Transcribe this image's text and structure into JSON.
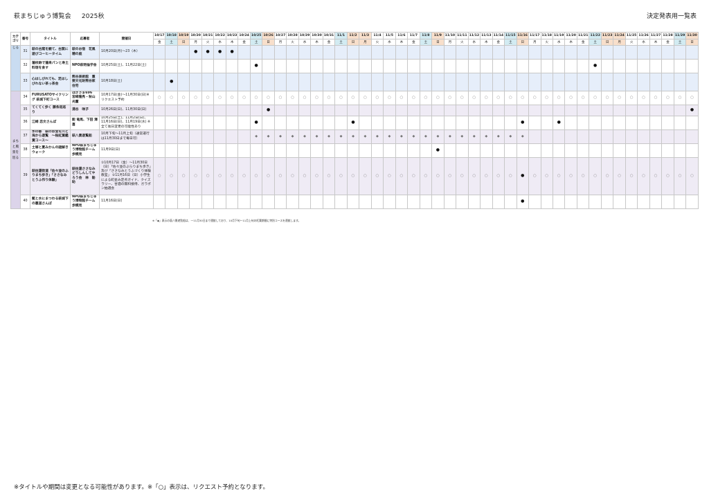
{
  "header": {
    "title": "萩まちじゅう博覧会",
    "season": "2025秋",
    "right": "決定発表用一覧表"
  },
  "columns": {
    "category": "カテゴリ",
    "no": "番号",
    "title": "タイトル",
    "organizer": "応募者",
    "period": "開催日"
  },
  "dates": [
    {
      "d": "10/17",
      "w": "金",
      "t": ""
    },
    {
      "d": "10/18",
      "w": "土",
      "t": "sat"
    },
    {
      "d": "10/19",
      "w": "日",
      "t": "sun"
    },
    {
      "d": "10/20",
      "w": "月",
      "t": ""
    },
    {
      "d": "10/21",
      "w": "火",
      "t": ""
    },
    {
      "d": "10/22",
      "w": "水",
      "t": ""
    },
    {
      "d": "10/23",
      "w": "木",
      "t": ""
    },
    {
      "d": "10/24",
      "w": "金",
      "t": ""
    },
    {
      "d": "10/25",
      "w": "土",
      "t": "sat"
    },
    {
      "d": "10/26",
      "w": "日",
      "t": "sun"
    },
    {
      "d": "10/27",
      "w": "月",
      "t": ""
    },
    {
      "d": "10/28",
      "w": "火",
      "t": ""
    },
    {
      "d": "10/29",
      "w": "水",
      "t": ""
    },
    {
      "d": "10/30",
      "w": "木",
      "t": ""
    },
    {
      "d": "10/31",
      "w": "金",
      "t": ""
    },
    {
      "d": "11/1",
      "w": "土",
      "t": "sat"
    },
    {
      "d": "11/2",
      "w": "日",
      "t": "sun"
    },
    {
      "d": "11/3",
      "w": "月",
      "t": "sun"
    },
    {
      "d": "11/4",
      "w": "火",
      "t": ""
    },
    {
      "d": "11/5",
      "w": "水",
      "t": ""
    },
    {
      "d": "11/6",
      "w": "木",
      "t": ""
    },
    {
      "d": "11/7",
      "w": "金",
      "t": ""
    },
    {
      "d": "11/8",
      "w": "土",
      "t": "sat"
    },
    {
      "d": "11/9",
      "w": "日",
      "t": "sun"
    },
    {
      "d": "11/10",
      "w": "月",
      "t": ""
    },
    {
      "d": "11/11",
      "w": "火",
      "t": ""
    },
    {
      "d": "11/12",
      "w": "水",
      "t": ""
    },
    {
      "d": "11/13",
      "w": "木",
      "t": ""
    },
    {
      "d": "11/14",
      "w": "金",
      "t": ""
    },
    {
      "d": "11/15",
      "w": "土",
      "t": "sat"
    },
    {
      "d": "11/16",
      "w": "日",
      "t": "sun"
    },
    {
      "d": "11/17",
      "w": "月",
      "t": ""
    },
    {
      "d": "11/18",
      "w": "火",
      "t": ""
    },
    {
      "d": "11/19",
      "w": "水",
      "t": ""
    },
    {
      "d": "11/20",
      "w": "木",
      "t": ""
    },
    {
      "d": "11/21",
      "w": "金",
      "t": ""
    },
    {
      "d": "11/22",
      "w": "土",
      "t": "sat"
    },
    {
      "d": "11/23",
      "w": "日",
      "t": "sun"
    },
    {
      "d": "11/24",
      "w": "月",
      "t": "sun"
    },
    {
      "d": "11/25",
      "w": "火",
      "t": ""
    },
    {
      "d": "11/26",
      "w": "水",
      "t": ""
    },
    {
      "d": "11/27",
      "w": "木",
      "t": ""
    },
    {
      "d": "11/28",
      "w": "金",
      "t": ""
    },
    {
      "d": "11/29",
      "w": "土",
      "t": "sat"
    },
    {
      "d": "11/30",
      "w": "日",
      "t": "sun"
    }
  ],
  "categories": [
    {
      "label": "じる",
      "rows": 3
    },
    {
      "label": "まちと風景を巡る",
      "rows": 7
    }
  ],
  "rows": [
    {
      "no": "31",
      "title": "萩の古窯を観て、古窯に遊びコーヒータイム",
      "organizer": "萩のお宿　花風穂の庭",
      "period": "10月20日(月)～23（木）",
      "g": "g1",
      "marks": {
        "10/20": "●",
        "10/21": "●",
        "10/22": "●",
        "10/23": "●"
      }
    },
    {
      "no": "32",
      "title": "藩校跡で藩来パンと寿土料理を食す",
      "organizer": "NPO萩明倫学舎",
      "period": "10月25日(土)、11月22日(土)",
      "g": "g2",
      "marks": {
        "10/25": "●",
        "11/22": "●"
      }
    },
    {
      "no": "33",
      "title": "心はしびれても、足はしびれない茶っ茶会",
      "organizer": "熊谷美術館　重要文化財熊谷家住宅",
      "period": "10月18日(土)",
      "g": "g1",
      "marks": {
        "10/18": "●"
      }
    },
    {
      "no": "34",
      "title": "FURUSATOサイクリング 萩城下町コース",
      "organizer": "はぎさま696　宮崎隆秀・秋山光董",
      "period": "10月17日(金)～11月30日(日)※リクエスト予約",
      "g": "g2",
      "fill": "○",
      "marks": {}
    },
    {
      "no": "35",
      "title": "てくてく歩く 藤条巡巡り",
      "organizer": "湯谷　咲子",
      "period": "10月26日(日)、11月30日(日)",
      "g": "g3",
      "marks": {
        "10/26": "●",
        "11/30": "●"
      }
    },
    {
      "no": "36",
      "title": "江崎 恋文さんぽ",
      "organizer": "能 竜馬、下田 澤喜",
      "period": "10月25日(土)、11月2日(日)、11月16日(日)、11月19日(水) ※全て後日変更の可能性あり",
      "g": "g2",
      "marks": {
        "10/25": "●",
        "11/2": "●",
        "11/16": "●",
        "11/19": "●"
      }
    },
    {
      "no": "37",
      "title": "水の都　萩のお堂を川と海から遊覧　～桜紅葉鑑賞コース～",
      "organizer": "萩八景遊覧船",
      "period": "10月下旬～11月上旬（通常運行は11月30日まで毎日可）",
      "g": "g3",
      "fillRange": [
        "10/25",
        "11/16"
      ],
      "fillMark": "◆",
      "marks": {}
    },
    {
      "no": "38",
      "title": "土塀と夏みかんの謎解きウォーク",
      "organizer": "NPO萩まちじゅう博物館チーム歩幌見",
      "period": "11月9日(日)",
      "g": "g2",
      "marks": {
        "11/9": "●"
      }
    },
    {
      "no": "39",
      "title": "萩往還街道「佐々並のふりまち歩き」「ささなみとうふ作り体験」",
      "organizer": "萩往還ささなみどうしんしてやろう会　林　勘助",
      "period": "①10月17日（金）～11月30日（日）「佐々並のぶらりまち歩き」及び「ささなみとうふづくり体験教室」 ②11月16日（日）小学生による町並み定点ガイド、クイズラリー、甘酒の無料接待、ガラポン抽選会",
      "g": "g3",
      "fill": "○",
      "marks": {
        "11/16": "●"
      }
    },
    {
      "no": "40",
      "title": "藍と水にまつわる萩城下の裏道さんぽ",
      "organizer": "NPO萩まちじゅう博物館チーム歩幌見",
      "period": "11月16日(日)",
      "g": "g2",
      "marks": {
        "11/16": "●"
      }
    }
  ],
  "notes": {
    "small": "※「◆」表示の萩八景遊覧船は、一11月30日まで運航しており、10月下旬一11月上旬の紅葉期間に特別コースを運航します。",
    "footer": "※タイトルや期間は変更となる可能性があります。※「○」表示は、リクエスト予約となります。"
  }
}
